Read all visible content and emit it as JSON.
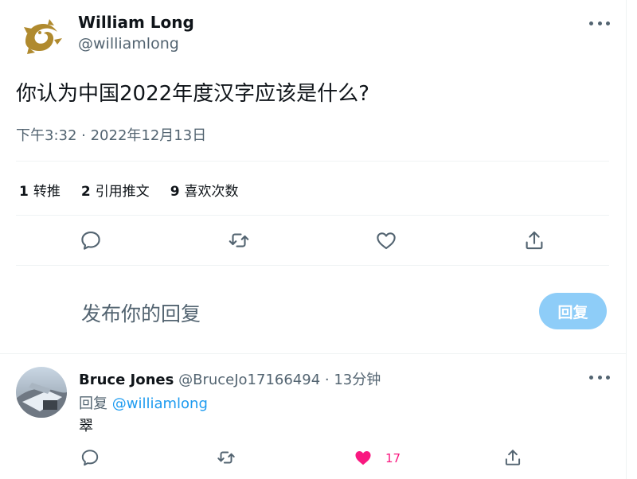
{
  "tweet": {
    "author_name": "William Long",
    "author_handle": "@williamlong",
    "text": "你认为中国2022年度汉字应该是什么?",
    "timestamp": "下午3:32 · 2022年12月13日",
    "stats": [
      {
        "count": "1",
        "label": "转推"
      },
      {
        "count": "2",
        "label": "引用推文"
      },
      {
        "count": "9",
        "label": "喜欢次数"
      }
    ],
    "actions": [
      "reply-icon",
      "retweet-icon",
      "like-icon",
      "share-icon"
    ]
  },
  "composer": {
    "placeholder": "发布你的回复",
    "button_label": "回复"
  },
  "reply": {
    "author_name": "Bruce Jones",
    "author_handle": "@BruceJo17166494",
    "time": "· 13分钟",
    "reply_to_label": "回复",
    "reply_to_handle": "@williamlong",
    "text": "翠",
    "like_count": "17"
  },
  "colors": {
    "accent": "#1d9bf0",
    "reply_button": "#8ecdf8",
    "like": "#f91880",
    "muted_text": "#536471",
    "dragon_logo": "#b08a2e"
  }
}
